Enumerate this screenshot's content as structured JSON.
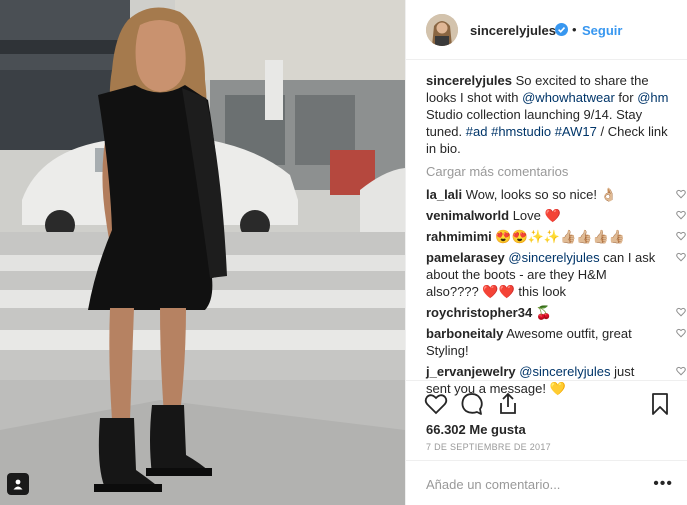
{
  "post": {
    "author": "sincerelyjules",
    "follow_label": "Seguir",
    "dot": "•",
    "caption": {
      "user": "sincerelyjules",
      "parts": [
        {
          "text": " So excited to share the looks I shot with ",
          "link": false
        },
        {
          "text": "@whowhatwear",
          "link": true
        },
        {
          "text": " for ",
          "link": false
        },
        {
          "text": "@hm",
          "link": true
        },
        {
          "text": " Studio collection launching 9/14. Stay tuned. ",
          "link": false
        },
        {
          "text": "#ad",
          "link": true
        },
        {
          "text": " ",
          "link": false
        },
        {
          "text": "#hmstudio",
          "link": true
        },
        {
          "text": " ",
          "link": false
        },
        {
          "text": "#AW17",
          "link": true
        },
        {
          "text": " / Check link in bio.",
          "link": false
        }
      ]
    },
    "load_more": "Cargar más comentarios",
    "comments": [
      {
        "user": "la_lali",
        "parts": [
          {
            "text": " Wow, looks so so nice! 👌🏼",
            "link": false
          }
        ]
      },
      {
        "user": "venimalworld",
        "parts": [
          {
            "text": " Love ❤️",
            "link": false
          }
        ]
      },
      {
        "user": "rahmimimi",
        "parts": [
          {
            "text": " 😍😍✨✨👍🏼👍🏼👍🏼👍🏼",
            "link": false
          }
        ]
      },
      {
        "user": "pamelarasey",
        "parts": [
          {
            "text": " ",
            "link": false
          },
          {
            "text": "@sincerelyjules",
            "link": true
          },
          {
            "text": " can I ask about the boots - are they H&M also???? ❤️❤️ this look",
            "link": false
          }
        ]
      },
      {
        "user": "roychristopher34",
        "parts": [
          {
            "text": " 🍒",
            "link": false
          }
        ]
      },
      {
        "user": "barboneitaly",
        "parts": [
          {
            "text": " Awesome outfit, great Styling!",
            "link": false
          }
        ]
      },
      {
        "user": "j_ervanjewelry",
        "parts": [
          {
            "text": " ",
            "link": false
          },
          {
            "text": "@sincerelyjules",
            "link": true
          },
          {
            "text": " just sent you a message! 💛",
            "link": false
          }
        ]
      }
    ],
    "likes": "66.302 Me gusta",
    "date": "7 DE SEPTIEMBRE DE 2017",
    "comment_placeholder": "Añade un comentario...",
    "more_options": "•••"
  },
  "colors": {
    "link": "#003569",
    "follow": "#3897f0",
    "muted": "#999999",
    "verified": "#3897f0"
  },
  "icons": [
    "verified-badge-icon",
    "heart-icon",
    "comment-icon",
    "share-icon",
    "bookmark-icon",
    "tag-person-icon",
    "small-heart-icon"
  ]
}
